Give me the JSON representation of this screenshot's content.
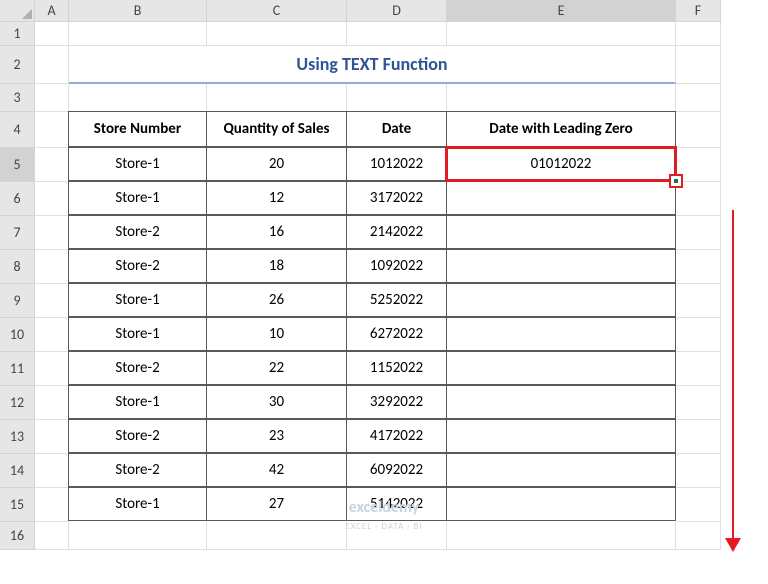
{
  "columns": [
    "A",
    "B",
    "C",
    "D",
    "E",
    "F"
  ],
  "rows": [
    "1",
    "2",
    "3",
    "4",
    "5",
    "6",
    "7",
    "8",
    "9",
    "10",
    "11",
    "12",
    "13",
    "14",
    "15",
    "16"
  ],
  "selected_col": "E",
  "selected_row": "5",
  "title": "Using TEXT Function",
  "headers": {
    "b": "Store Number",
    "c": "Quantity of Sales",
    "d": "Date",
    "e": "Date with Leading Zero"
  },
  "data": [
    {
      "store": "Store-1",
      "qty": "20",
      "date": "1012022",
      "lead": "01012022"
    },
    {
      "store": "Store-1",
      "qty": "12",
      "date": "3172022",
      "lead": ""
    },
    {
      "store": "Store-2",
      "qty": "16",
      "date": "2142022",
      "lead": ""
    },
    {
      "store": "Store-2",
      "qty": "18",
      "date": "1092022",
      "lead": ""
    },
    {
      "store": "Store-1",
      "qty": "26",
      "date": "5252022",
      "lead": ""
    },
    {
      "store": "Store-1",
      "qty": "10",
      "date": "6272022",
      "lead": ""
    },
    {
      "store": "Store-2",
      "qty": "22",
      "date": "1152022",
      "lead": ""
    },
    {
      "store": "Store-1",
      "qty": "30",
      "date": "3292022",
      "lead": ""
    },
    {
      "store": "Store-2",
      "qty": "23",
      "date": "4172022",
      "lead": ""
    },
    {
      "store": "Store-2",
      "qty": "42",
      "date": "6092022",
      "lead": ""
    },
    {
      "store": "Store-1",
      "qty": "27",
      "date": "5142022",
      "lead": ""
    }
  ],
  "watermark": {
    "main": "exceldemy",
    "sub": "EXCEL · DATA · BI"
  },
  "chart_data": {
    "type": "table",
    "title": "Using TEXT Function",
    "columns": [
      "Store Number",
      "Quantity of Sales",
      "Date",
      "Date with Leading Zero"
    ],
    "rows": [
      [
        "Store-1",
        20,
        1012022,
        "01012022"
      ],
      [
        "Store-1",
        12,
        3172022,
        ""
      ],
      [
        "Store-2",
        16,
        2142022,
        ""
      ],
      [
        "Store-2",
        18,
        1092022,
        ""
      ],
      [
        "Store-1",
        26,
        5252022,
        ""
      ],
      [
        "Store-1",
        10,
        6272022,
        ""
      ],
      [
        "Store-2",
        22,
        1152022,
        ""
      ],
      [
        "Store-1",
        30,
        3292022,
        ""
      ],
      [
        "Store-2",
        23,
        4172022,
        ""
      ],
      [
        "Store-2",
        42,
        6092022,
        ""
      ],
      [
        "Store-1",
        27,
        5142022,
        ""
      ]
    ]
  }
}
